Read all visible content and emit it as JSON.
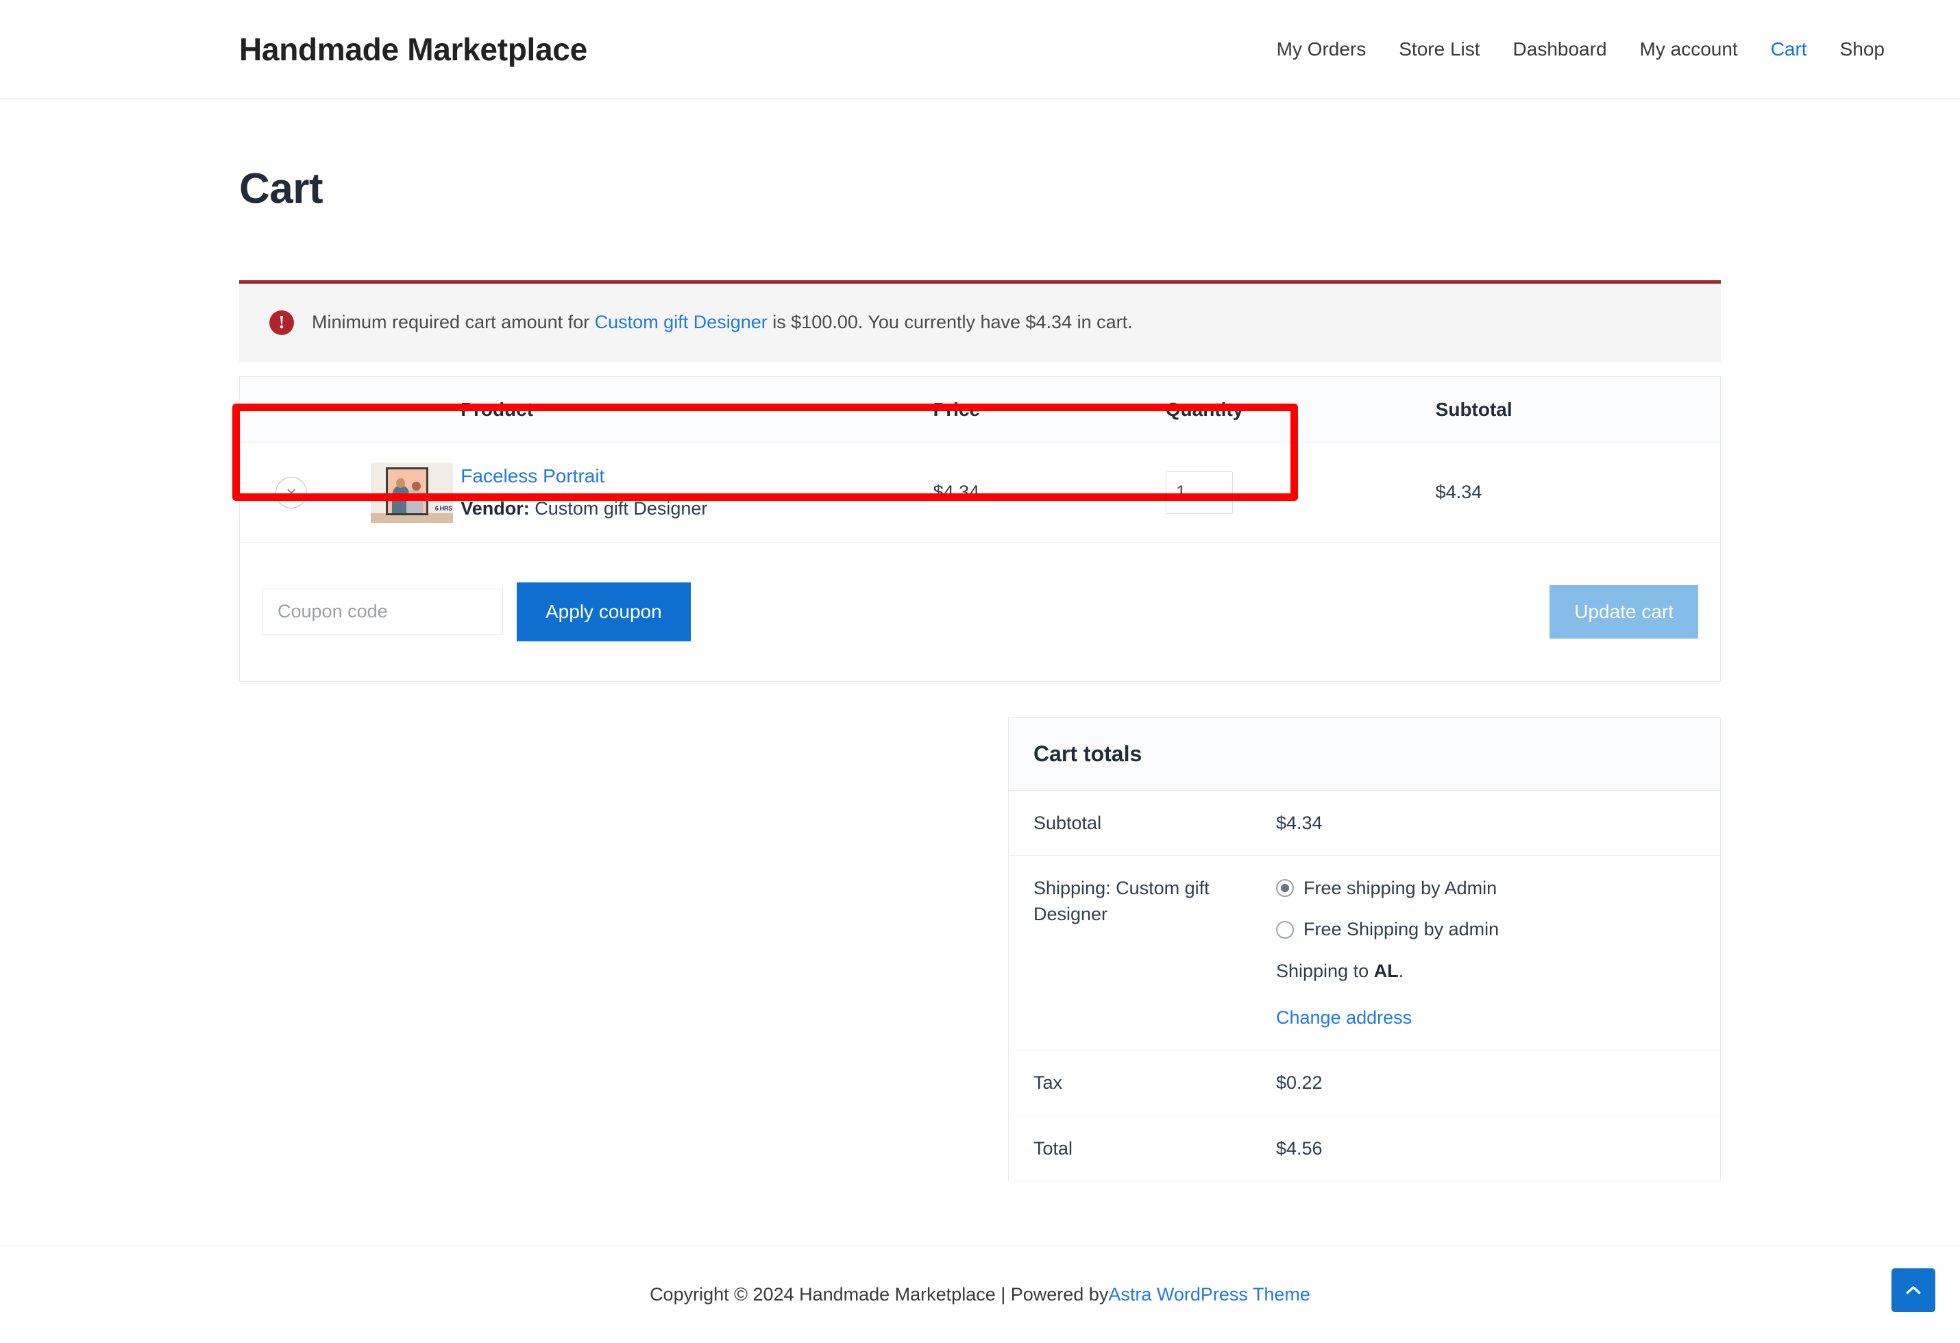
{
  "header": {
    "site_title": "Handmade Marketplace",
    "nav": [
      {
        "label": "My Orders",
        "current": false
      },
      {
        "label": "Store List",
        "current": false
      },
      {
        "label": "Dashboard",
        "current": false
      },
      {
        "label": "My account",
        "current": false
      },
      {
        "label": "Cart",
        "current": true
      },
      {
        "label": "Shop",
        "current": false
      }
    ]
  },
  "page": {
    "title": "Cart"
  },
  "notice": {
    "icon": "alert-circle-icon",
    "text_before": "Minimum required cart amount for ",
    "link_text": "Custom gift Designer",
    "text_after": " is $100.00. You currently have $4.34 in cart.",
    "border_color": "#a02628",
    "background_color": "#f5f5f5",
    "annotation_color": "#ff0000"
  },
  "cart_table": {
    "columns": [
      "",
      "",
      "Product",
      "Price",
      "Quantity",
      "Subtotal"
    ],
    "rows": [
      {
        "remove_label": "×",
        "thumb_badge": "6 HRS",
        "product_name": "Faceless Portrait",
        "vendor_label": "Vendor:",
        "vendor_name": "Custom gift Designer",
        "price": "$4.34",
        "quantity": "1",
        "subtotal": "$4.34"
      }
    ],
    "coupon": {
      "placeholder": "Coupon code",
      "value": "",
      "apply_label": "Apply coupon",
      "update_label": "Update cart"
    }
  },
  "cart_totals": {
    "heading": "Cart totals",
    "subtotal_label": "Subtotal",
    "subtotal_value": "$4.34",
    "shipping_label": "Shipping: Custom gift Designer",
    "shipping_options": [
      {
        "label": "Free shipping by Admin",
        "selected": true
      },
      {
        "label": "Free Shipping by admin",
        "selected": false
      }
    ],
    "shipping_to_prefix": "Shipping to ",
    "shipping_to_state": "AL",
    "shipping_to_suffix": ".",
    "change_address_label": "Change address",
    "tax_label": "Tax",
    "tax_value": "$0.22",
    "total_label": "Total",
    "total_value": "$4.56"
  },
  "footer": {
    "copyright_text": "Copyright © 2024 Handmade Marketplace | Powered by ",
    "theme_link": "Astra WordPress Theme",
    "scroll_top_icon": "chevron-up-icon"
  },
  "colors": {
    "accent_blue": "#1f7ae0",
    "button_blue": "#0f6fd1",
    "button_blue_disabled": "#85bce8",
    "notice_red": "#a02628",
    "annotation_red": "#ff0000",
    "heading_dark": "#222b38"
  }
}
